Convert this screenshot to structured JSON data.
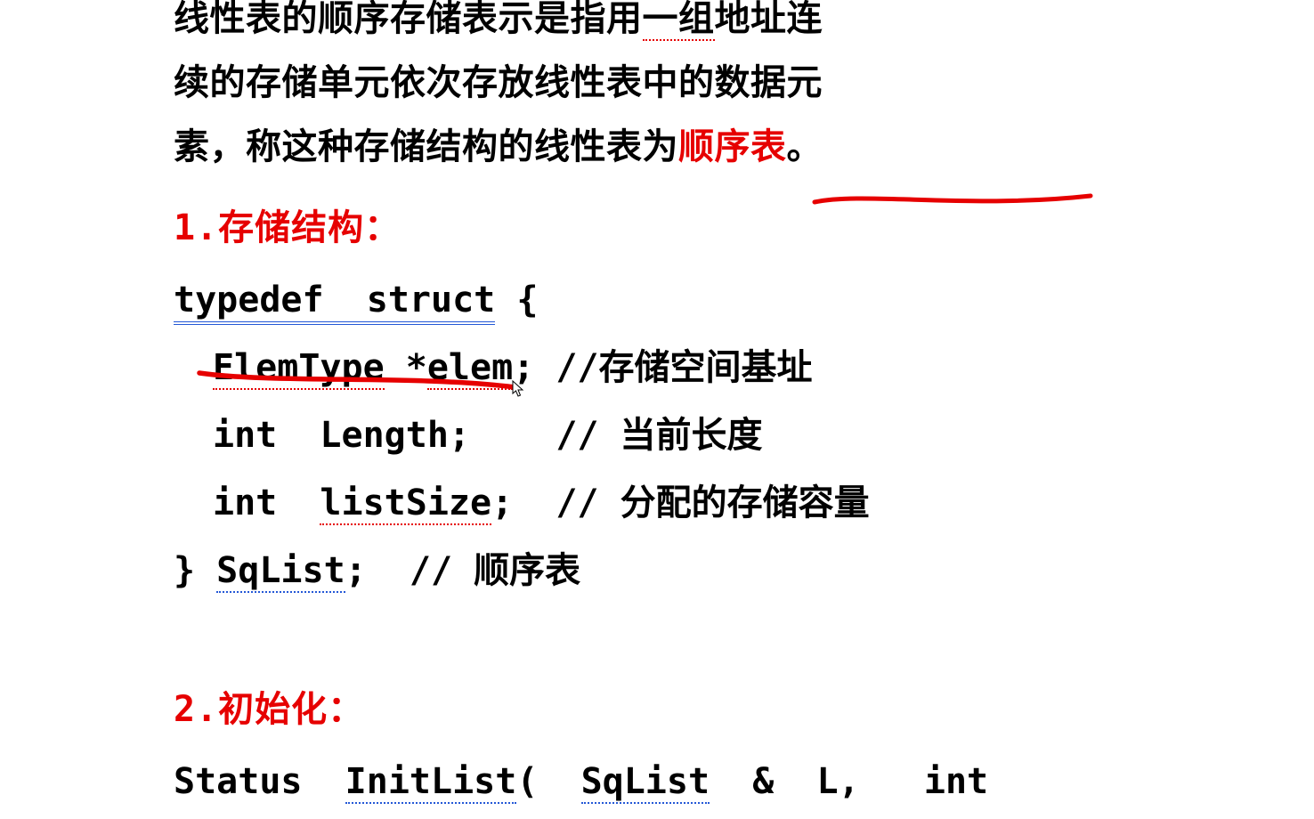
{
  "para": {
    "line1": "线性表的顺序存储表示是指用",
    "line1b": "一组",
    "line1c": "地址连",
    "line2": "续的存储单元依次存放线性表中的数据元",
    "line3a": "素，称这种存储结构的线性表为",
    "line3b": "顺序表",
    "line3c": "。"
  },
  "heading1": "1.存储结构：",
  "code": {
    "l1a": "typedef  struct",
    "l1b": " {",
    "l2a": "ElemType",
    "l2b": " *",
    "l2c": "elem",
    "l2d": "; //存储空间基址",
    "l3": "int  Length;    // 当前长度",
    "l4a": "int  ",
    "l4b": "listSize",
    "l4c": ";  // 分配的存储容量",
    "l5a": "} ",
    "l5b": "SqList",
    "l5c": ";  // 顺序表"
  },
  "heading2": "2.初始化：",
  "code2": {
    "l1a": "Status  ",
    "l1b": "InitList",
    "l1c": "(  ",
    "l1d": "SqList",
    "l1e": "  &  L,   int"
  },
  "colors": {
    "red": "#e60000",
    "blue": "#2458d6"
  }
}
